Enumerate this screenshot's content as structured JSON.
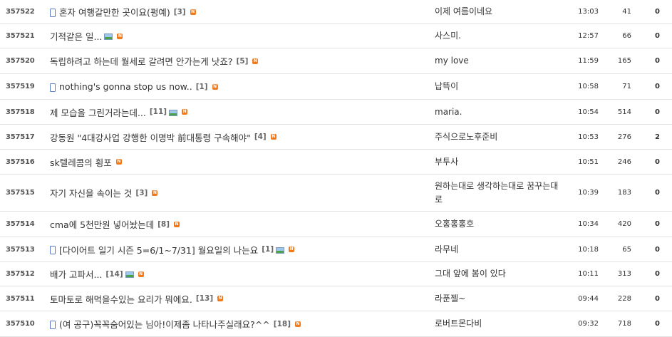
{
  "posts": [
    {
      "num": "357522",
      "mobile": true,
      "title": "혼자 여행갈만한 곳이요(펑예)",
      "comments": "[3]",
      "image": false,
      "new": "N",
      "writer": "이제 여름이네요",
      "time": "13:03",
      "views": "41",
      "recs": "0"
    },
    {
      "num": "357521",
      "mobile": false,
      "title": "기적같은 일...",
      "comments": "",
      "image": true,
      "new": "N",
      "writer": "사스미.",
      "time": "12:57",
      "views": "66",
      "recs": "0"
    },
    {
      "num": "357520",
      "mobile": false,
      "title": "독립하려고 하는데 월세로 갈려면 안가는게 낫죠?",
      "comments": "[5]",
      "image": false,
      "new": "N",
      "writer": "my love",
      "time": "11:59",
      "views": "165",
      "recs": "0"
    },
    {
      "num": "357519",
      "mobile": true,
      "title": "nothing's gonna stop us now..",
      "comments": "[1]",
      "image": false,
      "new": "N",
      "writer": "납뜩이",
      "time": "10:58",
      "views": "71",
      "recs": "0"
    },
    {
      "num": "357518",
      "mobile": false,
      "title": "제 모습을 그린거라는데...",
      "comments": "[11]",
      "image": true,
      "new": "N",
      "writer": "maria.",
      "time": "10:54",
      "views": "514",
      "recs": "0"
    },
    {
      "num": "357517",
      "mobile": false,
      "title": "강동원 \"4대강사업 강행한 이명박 前대통령 구속해야\"",
      "comments": "[4]",
      "image": false,
      "new": "N",
      "writer": "주식으로노후준비",
      "time": "10:53",
      "views": "276",
      "recs": "2"
    },
    {
      "num": "357516",
      "mobile": false,
      "title": "sk텔레콤의 횡포",
      "comments": "",
      "image": false,
      "new": "N",
      "writer": "부투사",
      "time": "10:51",
      "views": "246",
      "recs": "0"
    },
    {
      "num": "357515",
      "mobile": false,
      "title": "자기 자신을 속이는 것",
      "comments": "[3]",
      "image": false,
      "new": "N",
      "writer": "원하는대로 생각하는대로 꿈꾸는대로",
      "time": "10:39",
      "views": "183",
      "recs": "0"
    },
    {
      "num": "357514",
      "mobile": false,
      "title": "cma에 5천만원 넣어놨는데",
      "comments": "[8]",
      "image": false,
      "new": "N",
      "writer": "오홍홍홍호",
      "time": "10:34",
      "views": "420",
      "recs": "0"
    },
    {
      "num": "357513",
      "mobile": true,
      "title": "[다이어트 일기 시즌 5=6/1~7/31] 월요일의 나는요",
      "comments": "[1]",
      "image": true,
      "new": "N",
      "writer": "라무네",
      "time": "10:18",
      "views": "65",
      "recs": "0"
    },
    {
      "num": "357512",
      "mobile": false,
      "title": "배가 고파서...",
      "comments": "[14]",
      "image": true,
      "new": "N",
      "writer": "그대 앞에 봄이 있다",
      "time": "10:11",
      "views": "313",
      "recs": "0"
    },
    {
      "num": "357511",
      "mobile": false,
      "title": "토마토로 해먹을수있는 요리가 뭐에요.",
      "comments": "[13]",
      "image": false,
      "new": "N",
      "writer": "라푼젤~",
      "time": "09:44",
      "views": "228",
      "recs": "0"
    },
    {
      "num": "357510",
      "mobile": true,
      "title": "(여 공구)꼭꼭숨어있는 님아!이제좀 나타나주실래요?^^",
      "comments": "[18]",
      "image": false,
      "new": "N",
      "writer": "로버트몬다비",
      "time": "09:32",
      "views": "718",
      "recs": "0"
    }
  ]
}
